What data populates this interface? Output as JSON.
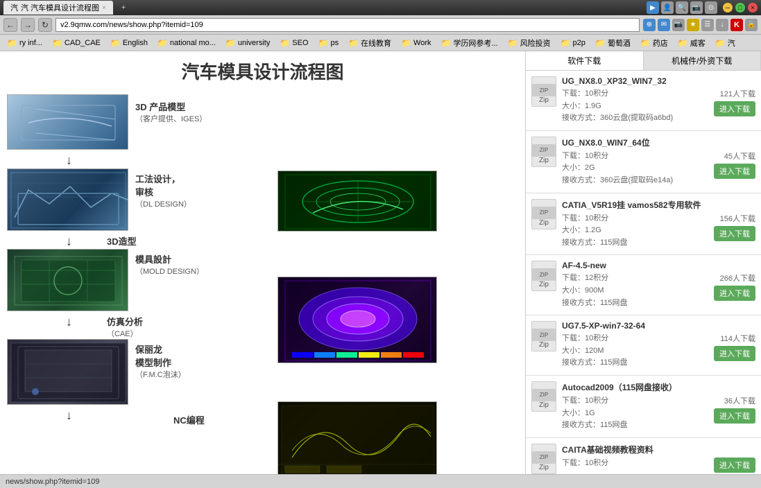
{
  "titlebar": {
    "tab1_label": "汽 汽车模具设计流程图",
    "tab1_close": "×",
    "tab_new": "+",
    "window_min": "─",
    "window_max": "□",
    "window_close": "×"
  },
  "addressbar": {
    "url": "v2.9qmw.com/news/show.php?itemid=109",
    "back": "←",
    "forward": "→",
    "reload": "↻"
  },
  "bookmarks": {
    "items": [
      {
        "label": "ry inf...",
        "folder": true
      },
      {
        "label": "CAD_CAE",
        "folder": true
      },
      {
        "label": "English",
        "folder": true
      },
      {
        "label": "national mo...",
        "folder": true
      },
      {
        "label": "university",
        "folder": true
      },
      {
        "label": "SEO",
        "folder": true
      },
      {
        "label": "ps",
        "folder": true
      },
      {
        "label": "在线教育",
        "folder": true
      },
      {
        "label": "Work",
        "folder": true
      },
      {
        "label": "学历网参考...",
        "folder": true
      },
      {
        "label": "风险投资",
        "folder": true
      },
      {
        "label": "p2p",
        "folder": true
      },
      {
        "label": "葡萄酒",
        "folder": true
      },
      {
        "label": "药店",
        "folder": true
      },
      {
        "label": "威客",
        "folder": true
      },
      {
        "label": "汽",
        "folder": true
      }
    ]
  },
  "sidebar_tabs": {
    "tab1": "软件下载",
    "tab2": "机械件/外资下载"
  },
  "page": {
    "title": "汽车模具设计流程图",
    "steps": [
      {
        "label": "3D 产品模型",
        "sublabel": "（客户提供、IGES）"
      },
      {
        "label": "工法设计，",
        "sublabel2": "审核",
        "sublabel3": "（DL DESIGN）"
      },
      {
        "label": "3D造型",
        "side": true
      },
      {
        "label": "模具設計",
        "sublabel": "（MOLD DESIGN）"
      },
      {
        "label": "仿真分析",
        "sublabel": "（CAE）",
        "side": true
      },
      {
        "label": "保丽龙",
        "sublabel2": "模型制作",
        "sublabel3": "（F.M.C泡沫）"
      },
      {
        "label": "NC编程"
      }
    ]
  },
  "downloads": [
    {
      "title": "UG_NX8.0_XP32_WIN7_32",
      "score": "下载：10积分",
      "size": "大小：1.9G",
      "method": "接收方式：360云盘(提取码a6bd)",
      "count": "121人下载",
      "btn": "进入下载"
    },
    {
      "title": "UG_NX8.0_WIN7_64位",
      "score": "下载：10积分",
      "size": "大小：2G",
      "method": "接收方式：360云盘(提取码e14a)",
      "count": "45人下载",
      "btn": "进入下载"
    },
    {
      "title": "CATIA_V5R19挂 vamos582专用软件",
      "score": "下载：10积分",
      "size": "大小：1.2G",
      "method": "接收方式：115网盘",
      "count": "156人下载",
      "btn": "进入下载"
    },
    {
      "title": "AF-4.5-new",
      "score": "下载：12积分",
      "size": "大小：900M",
      "method": "接收方式：115网盘",
      "count": "266人下载",
      "btn": "进入下载"
    },
    {
      "title": "UG7.5-XP-win7-32-64",
      "score": "下载：10积分",
      "size": "大小：120M",
      "method": "接收方式：115网盘",
      "count": "114人下载",
      "btn": "进入下载"
    },
    {
      "title": "Autocad2009（115网盘接收）",
      "score": "下载：10积分",
      "size": "大小：1G",
      "method": "接收方式：115网盘",
      "count": "36人下载",
      "btn": "进入下载"
    },
    {
      "title": "CAITA基础视频教程资料",
      "score": "下载：10积分",
      "size": "",
      "method": "",
      "count": "",
      "btn": "进入下载"
    }
  ],
  "statusbar": {
    "url": "news/show.php?itemid=109"
  }
}
